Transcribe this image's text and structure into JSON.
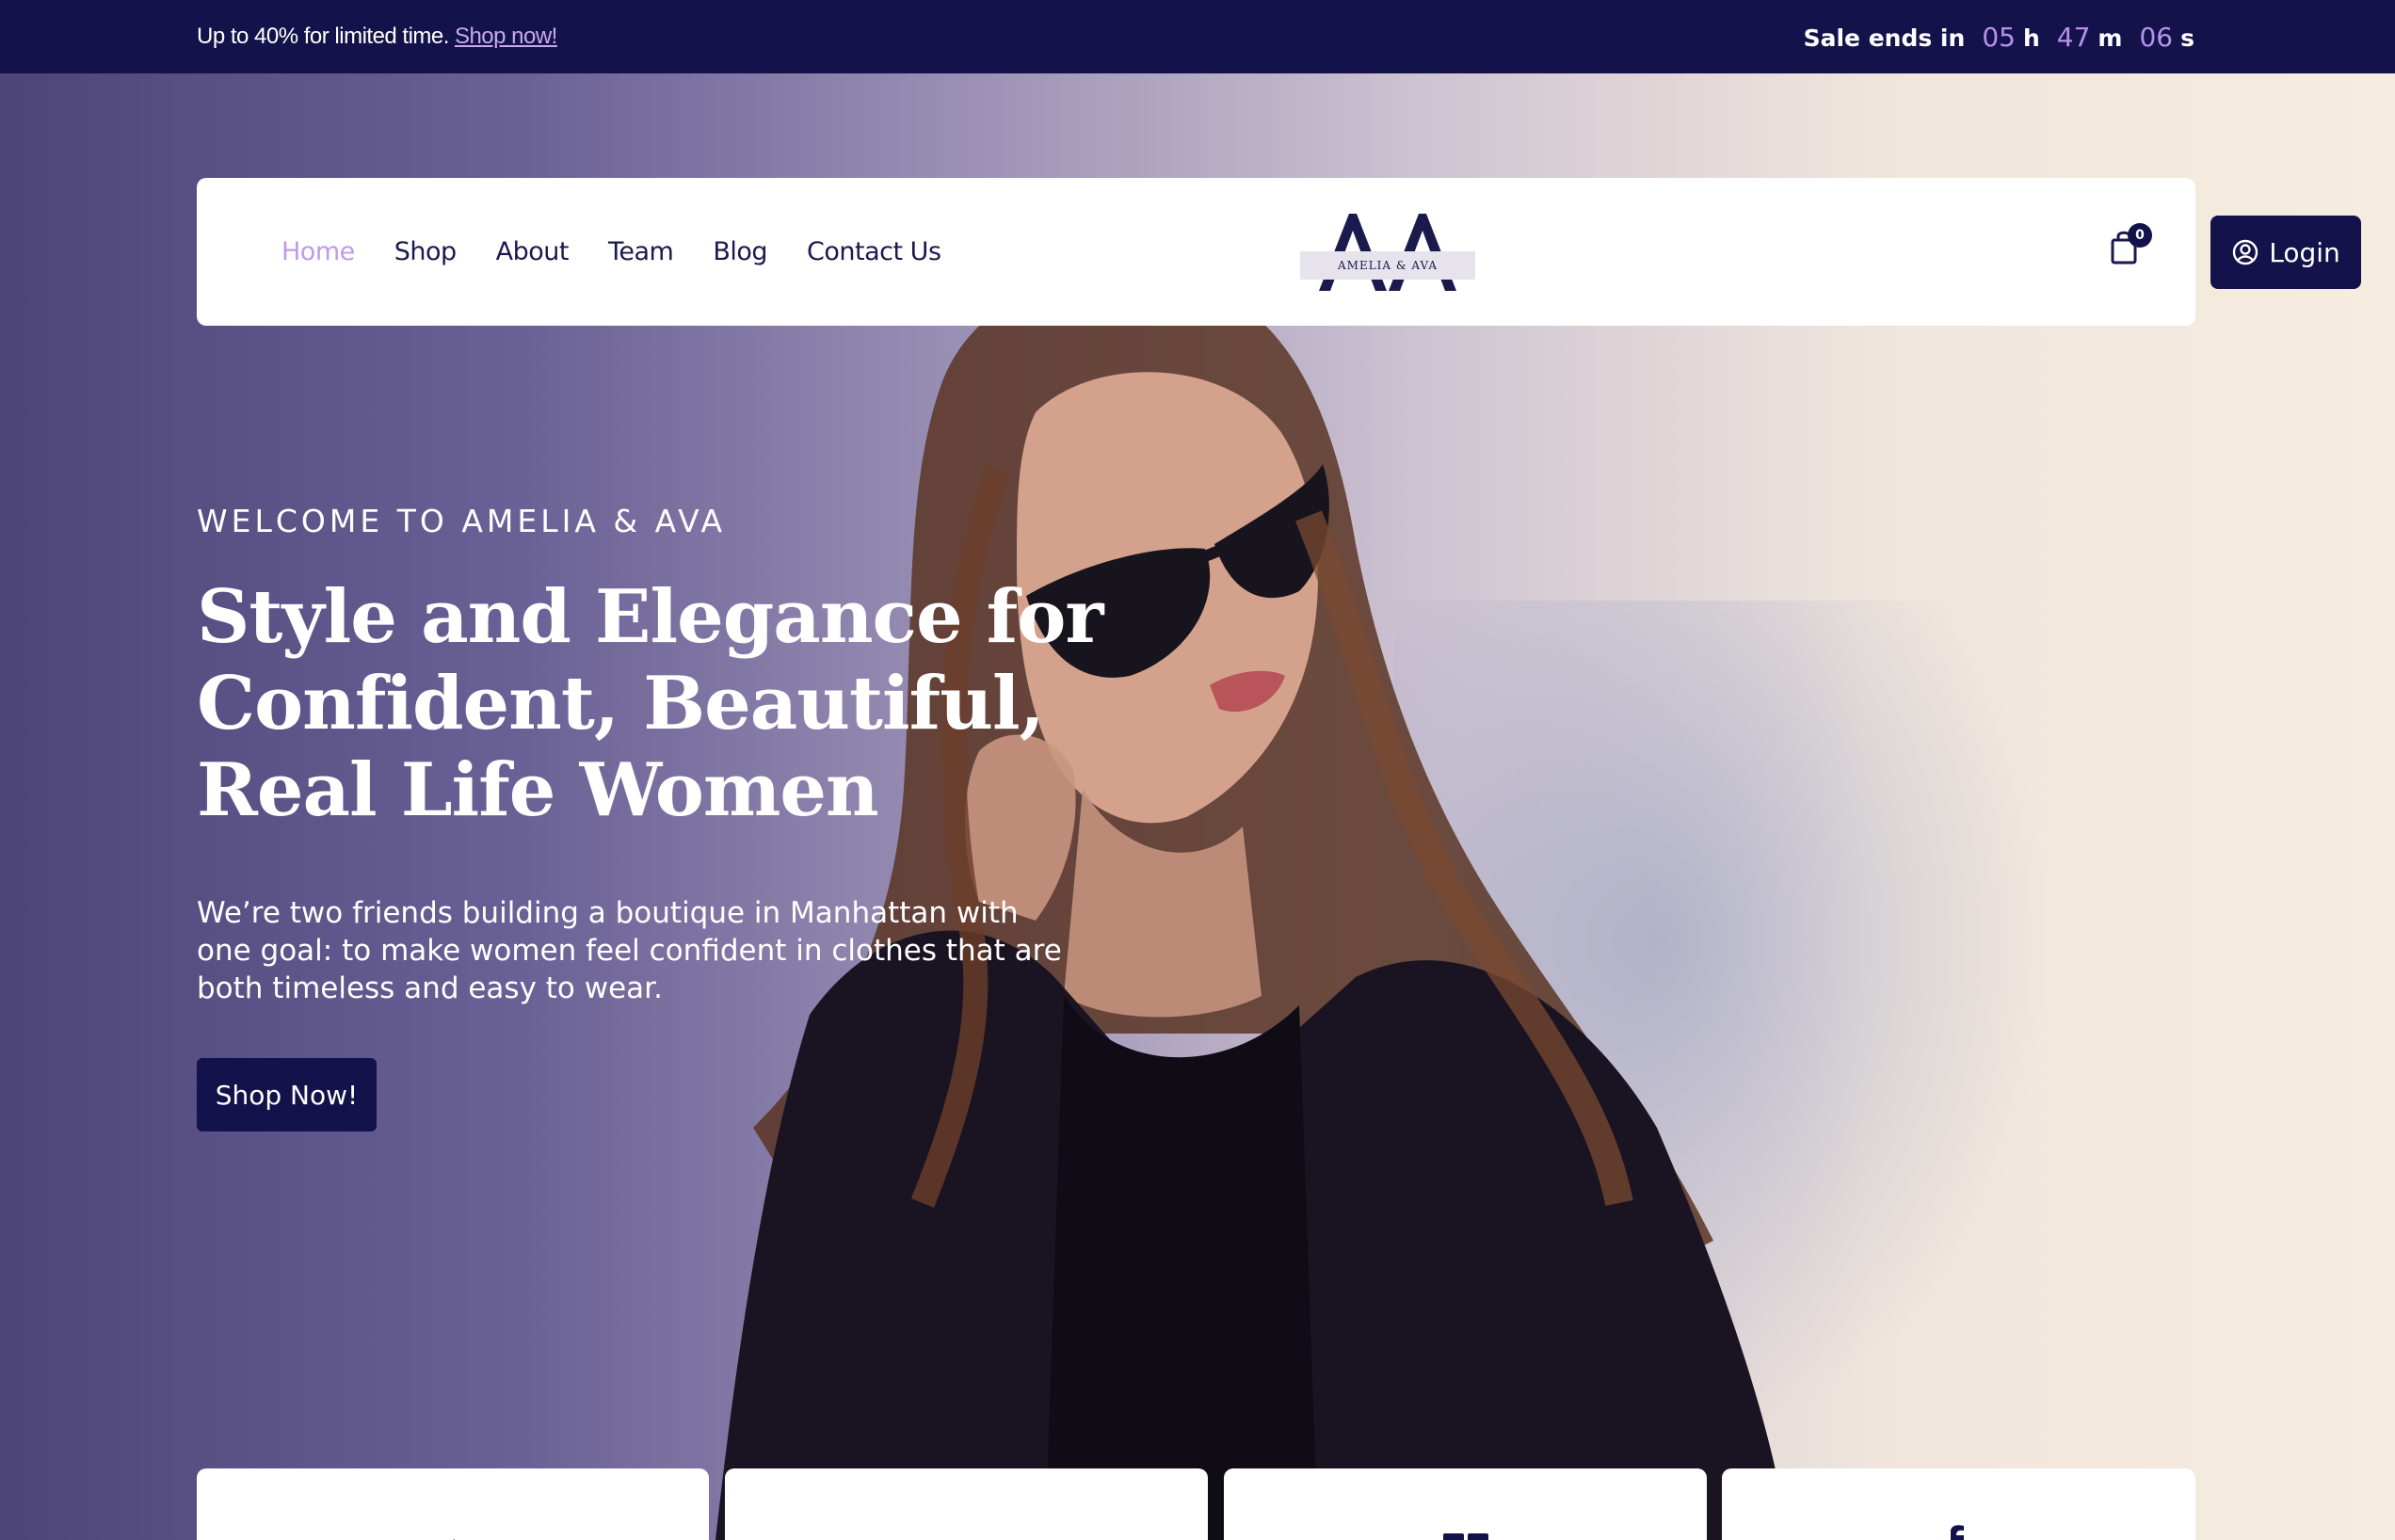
{
  "topbar": {
    "promo_text": "Up to 40% for limited time.",
    "promo_link": "Shop now!",
    "sale_label": "Sale ends in",
    "hours": "05",
    "hours_unit": "h",
    "minutes": "47",
    "minutes_unit": "m",
    "seconds": "06",
    "seconds_unit": "s"
  },
  "nav": {
    "items": [
      {
        "label": "Home",
        "active": true
      },
      {
        "label": "Shop"
      },
      {
        "label": "About"
      },
      {
        "label": "Team"
      },
      {
        "label": "Blog"
      },
      {
        "label": "Contact Us"
      }
    ],
    "logo_text": "AMELIA & AVA",
    "cart_count": "0",
    "login_label": "Login"
  },
  "hero": {
    "eyebrow": "WELCOME TO AMELIA & AVA",
    "headline_line1": "Style and Elegance for",
    "headline_line2": "Confident, Beautiful,",
    "headline_line3": "Real Life Women",
    "lede": "We’re two friends building a boutique in Manhattan with one goal: to make women feel confident in clothes that are both timeless and easy to wear.",
    "cta_label": "Shop Now!"
  },
  "colors": {
    "navy": "#14124a",
    "accent_lilac": "#c29be8",
    "white": "#ffffff"
  }
}
